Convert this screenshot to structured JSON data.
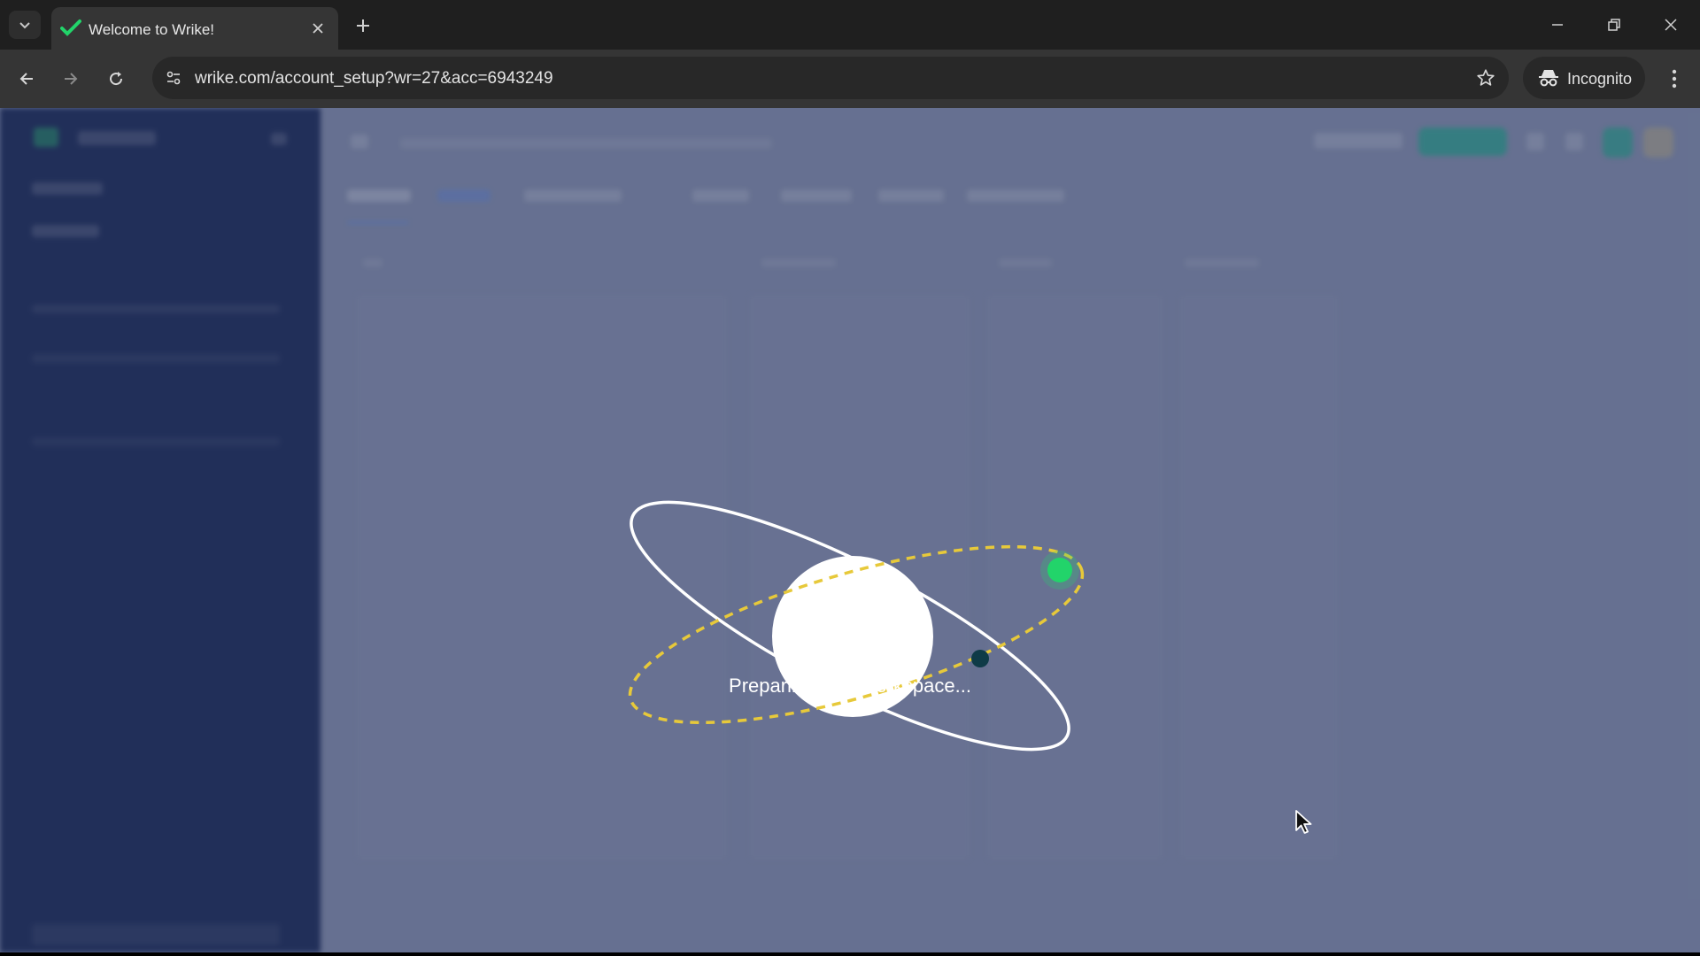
{
  "browser": {
    "tab": {
      "title": "Welcome to Wrike!",
      "favicon": "wrike-check-icon"
    },
    "address_bar": {
      "url": "wrike.com/account_setup?wr=27&acc=6943249"
    },
    "profile_label": "Incognito",
    "colors": {
      "tabstrip": "#1f1f1f",
      "toolbar": "#353535",
      "omnibox": "#282828"
    }
  },
  "page": {
    "loading_message": "Preparing your workspace...",
    "colors": {
      "sidebar": "#0e1e4a",
      "main_background": "#6a7594",
      "brand_green": "#22d46a",
      "orbit_yellow": "#e7c93a",
      "moon_dark": "#0f3b47"
    }
  }
}
